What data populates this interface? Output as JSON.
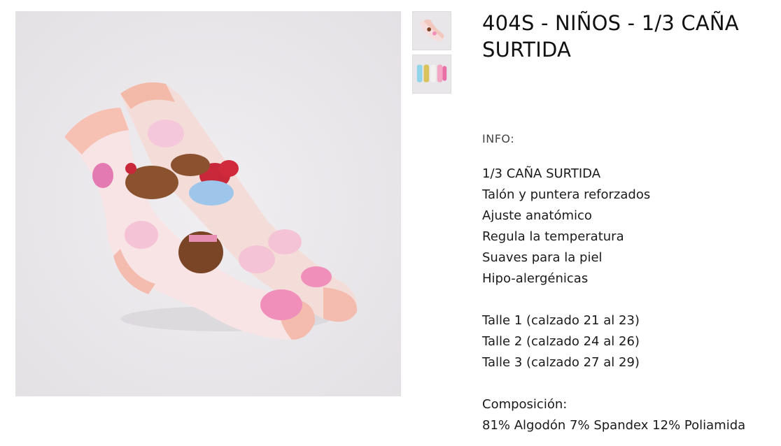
{
  "product": {
    "title": "404S - NIÑOS - 1/3 CAÑA SURTIDA",
    "info_label": "INFO:",
    "features": [
      "1/3 CAÑA SURTIDA",
      "Talón y puntera reforzados",
      "Ajuste anatómico",
      "Regula la temperatura",
      "Suaves para la piel",
      "Hipo-alergénicas"
    ],
    "sizes": [
      "Talle 1 (calzado 21 al 23)",
      "Talle 2 (calzado 24 al 26)",
      "Talle 3 (calzado 27 al 29)"
    ],
    "composition_label": "Composición:",
    "composition": "81% Algodón 7% Spandex 12% Poliamida"
  },
  "gallery": {
    "main_image": "kids-socks-photo",
    "thumbnails": [
      "kids-socks-pair-thumbnail",
      "kids-socks-assorted-thumbnail"
    ]
  },
  "colors": {
    "image_background": "#e8e6e9",
    "sock_pink": "#f7d0c8",
    "sock_light": "#f6e3e4",
    "accent_brown": "#7a4526"
  }
}
